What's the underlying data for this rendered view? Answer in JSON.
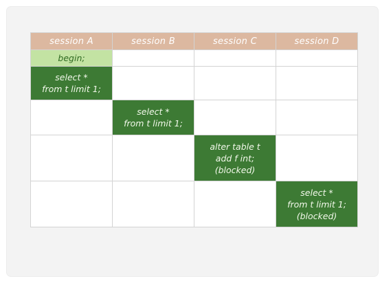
{
  "table": {
    "headers": [
      "session A",
      "session B",
      "session C",
      "session D"
    ],
    "rows": [
      [
        "begin;",
        "",
        "",
        ""
      ],
      [
        "select *\nfrom t limit 1;",
        "",
        "",
        ""
      ],
      [
        "",
        "select *\nfrom t limit 1;",
        "",
        ""
      ],
      [
        "",
        "",
        "alter table t\nadd f int;\n(blocked)",
        ""
      ],
      [
        "",
        "",
        "",
        "select *\nfrom t limit 1;\n(blocked)"
      ]
    ]
  },
  "colors": {
    "header_bg": "#dcb8a0",
    "light_green": "#c3e3a3",
    "dark_green": "#3d7a34",
    "grid_line": "#d3d3d3"
  }
}
